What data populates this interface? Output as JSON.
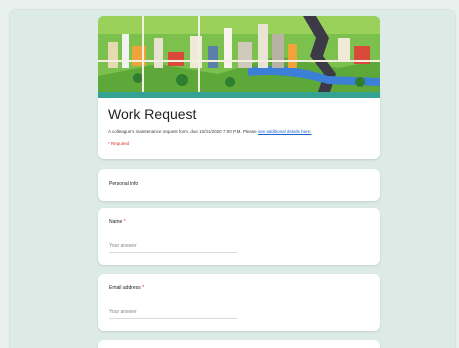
{
  "form": {
    "title": "Work Request",
    "description_text": "A colleague's maintenance request form, due 10/31/2020 7:00 P.M. Please ",
    "description_link": "see additional details here.",
    "required_note": "* Required"
  },
  "section": {
    "label": "Personal info"
  },
  "questions": [
    {
      "label": "Name",
      "required_mark": "*",
      "placeholder": "Your answer"
    },
    {
      "label": "Email address",
      "required_mark": "*",
      "placeholder": "Your answer"
    }
  ],
  "colors": {
    "accent": "#34a394",
    "background": "#ddebe7",
    "required": "#d93025",
    "link": "#1a63d0"
  }
}
